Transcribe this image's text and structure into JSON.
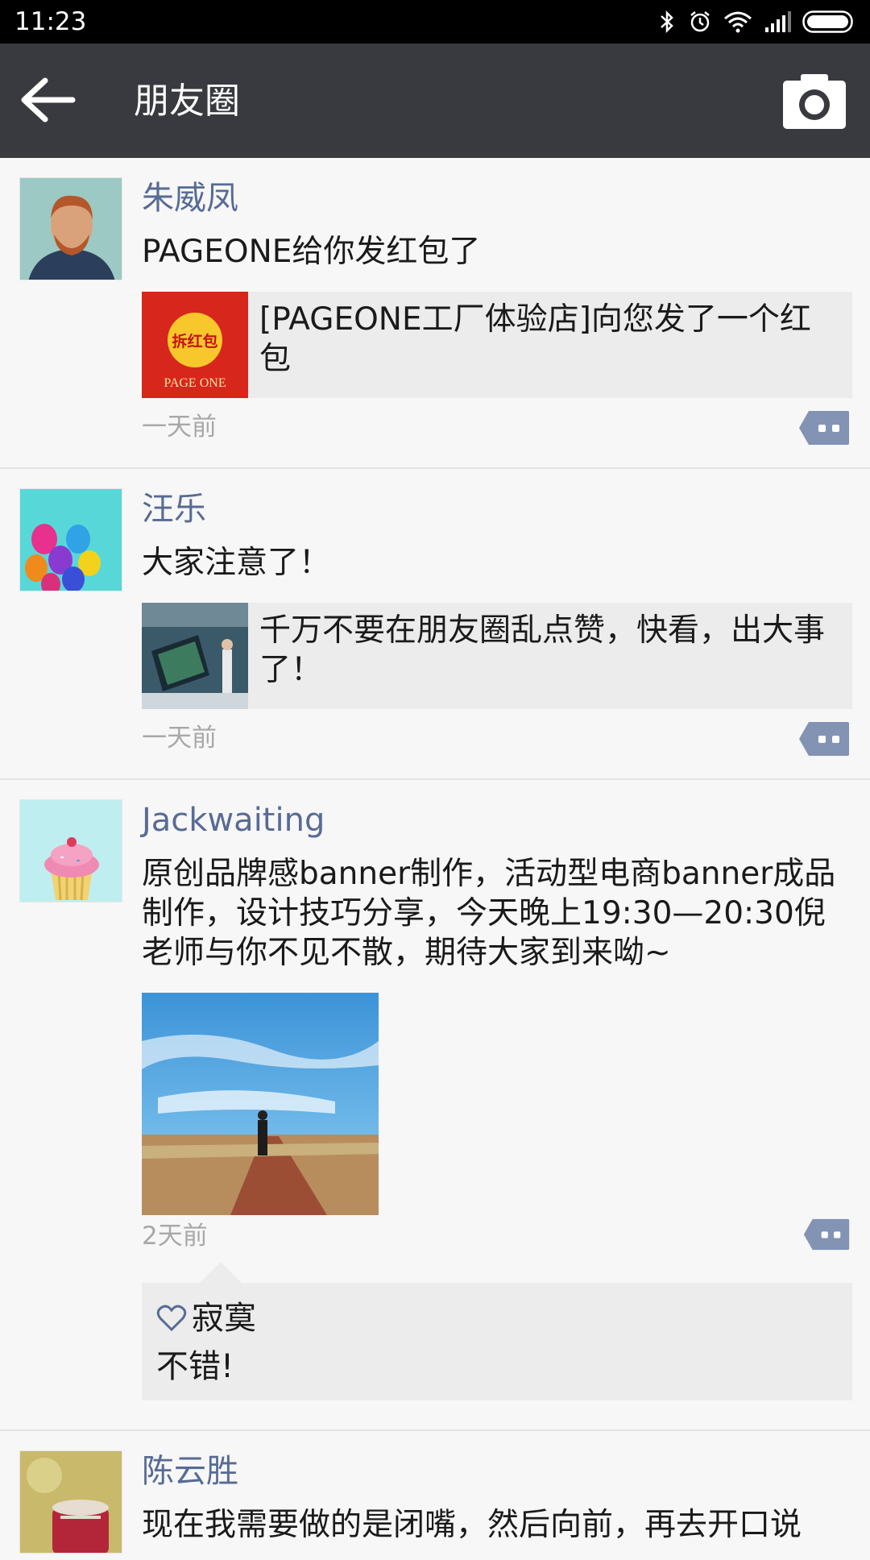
{
  "status_bar": {
    "time": "11:23",
    "icons": [
      "bluetooth-icon",
      "alarm-icon",
      "wifi-icon",
      "signal-icon",
      "battery-icon"
    ]
  },
  "header": {
    "title": "朋友圈",
    "back_icon": "back-arrow-icon",
    "camera_icon": "camera-icon"
  },
  "colors": {
    "status_bar": "#000000",
    "header": "#393a3f",
    "name": "#576b95",
    "background": "#f7f7f7",
    "card": "#ececec"
  },
  "posts": [
    {
      "name": "朱威凤",
      "text": "PAGEONE给你发红包了",
      "link_title": "[PAGEONE工厂体验店]向您发了一个红包",
      "link_thumb_text": "拆红包",
      "link_thumb_brand": "PAGE ONE",
      "time": "一天前"
    },
    {
      "name": "汪乐",
      "text": "大家注意了！",
      "link_title": "千万不要在朋友圈乱点赞，快看，出大事了！",
      "time": "一天前"
    },
    {
      "name": "Jackwaiting",
      "text": "原创品牌感banner制作，活动型电商banner成品制作，设计技巧分享，今天晚上19:30—20:30倪老师与你不见不散，期待大家到来呦~",
      "time": "2天前",
      "like_name": "寂寞",
      "comment": "不错!"
    },
    {
      "name": "陈云胜",
      "text": "现在我需要做的是闭嘴，然后向前，再去开口说"
    }
  ]
}
